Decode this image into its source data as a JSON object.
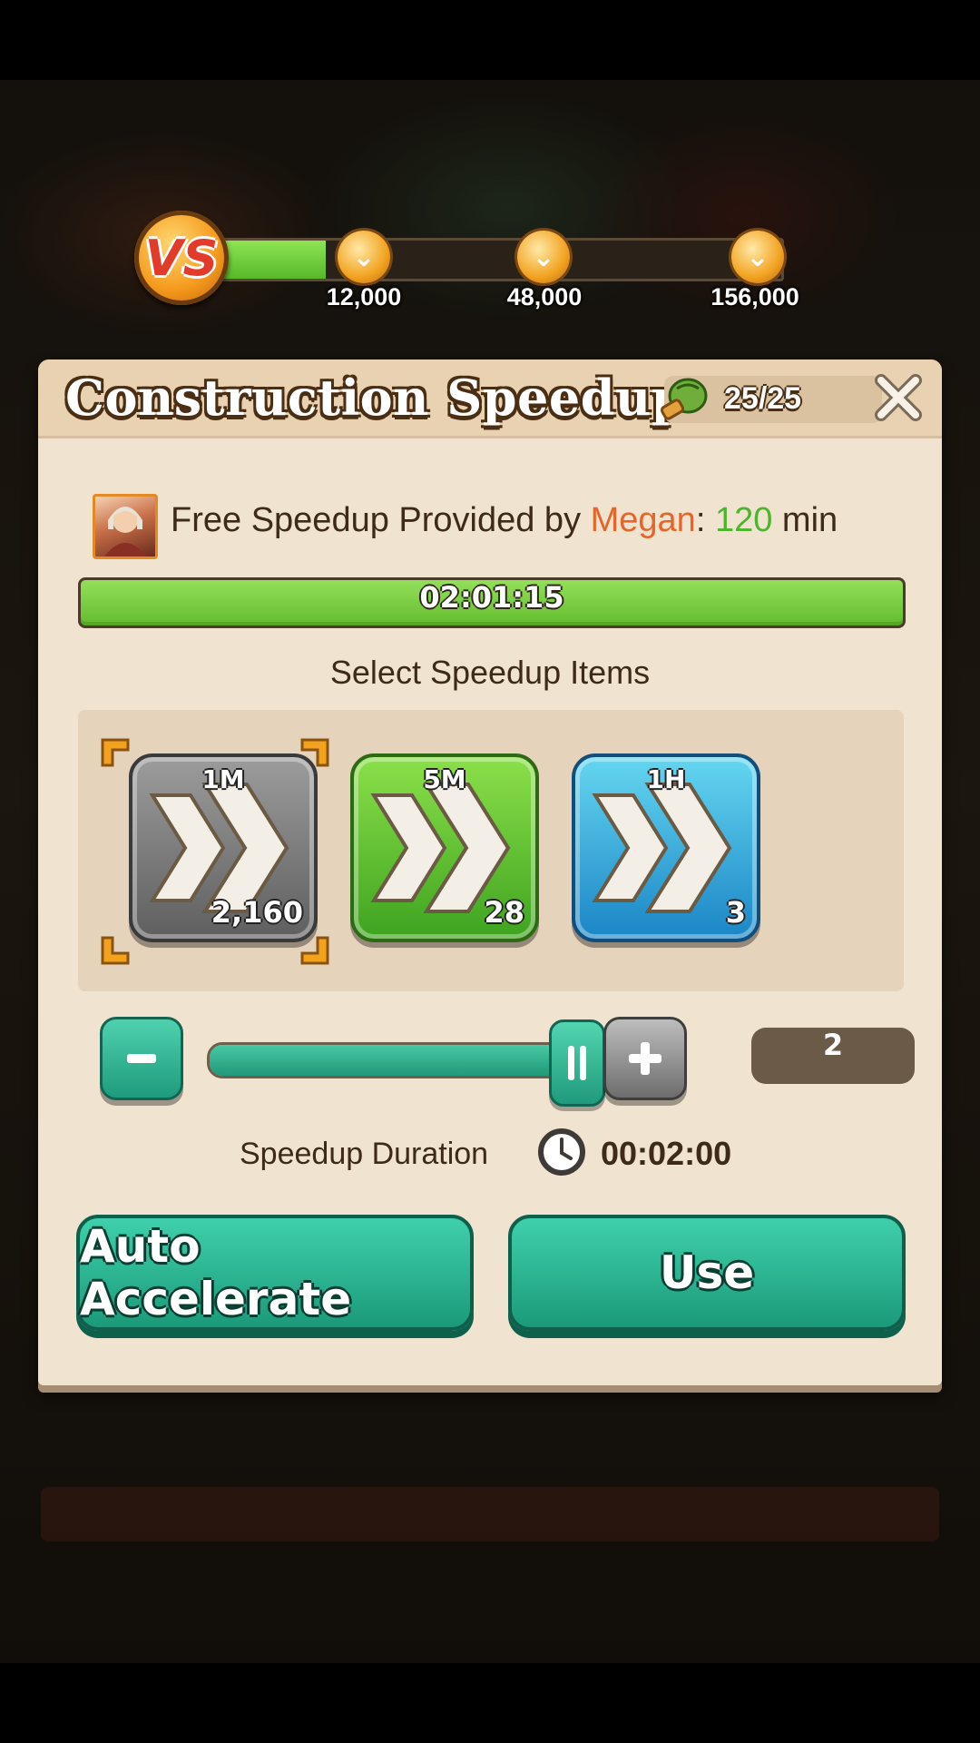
{
  "top_progress": {
    "fill_fraction": 0.19,
    "milestones": [
      "12,000",
      "48,000",
      "156,000"
    ]
  },
  "dialog": {
    "title": "Construction Speedup",
    "stamina": "25/25",
    "free_speedup": {
      "prefix": "Free Speedup Provided by ",
      "hero": "Megan",
      "separator": ": ",
      "minutes": "120",
      "unit": " min"
    },
    "remaining_time": "02:01:15",
    "select_label": "Select Speedup Items",
    "items": [
      {
        "duration": "1M",
        "count": "2,160",
        "color": "gray",
        "selected": true
      },
      {
        "duration": "5M",
        "count": "28",
        "color": "green",
        "selected": false
      },
      {
        "duration": "1H",
        "count": "3",
        "color": "blue",
        "selected": false
      }
    ],
    "quantity": "2",
    "slider_fraction": 1.0,
    "duration_label": "Speedup Duration",
    "duration_value": "00:02:00",
    "auto_button": "Auto Accelerate",
    "use_button": "Use"
  },
  "colors": {
    "accent": "#21987a",
    "hero_name": "#e8652a",
    "minutes": "#4cb52b",
    "progress": "#63bb2d"
  }
}
